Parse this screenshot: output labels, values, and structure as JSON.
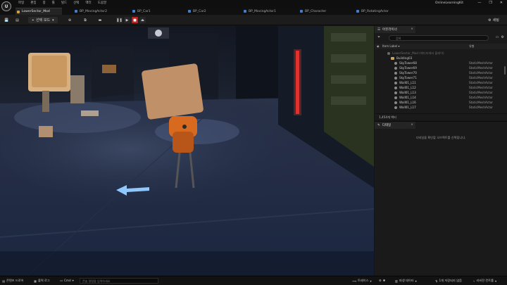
{
  "app": {
    "logo": "U",
    "menu": [
      "파일",
      "편집",
      "창",
      "툴",
      "빌드",
      "선택",
      "액터",
      "도움말"
    ],
    "project_name": "OnlineLearningKit",
    "window_controls": [
      "—",
      "❐",
      "✕"
    ]
  },
  "tabs": [
    {
      "label": "LowerSector_Mod",
      "icon": "level-icon",
      "active": true
    },
    {
      "label": "BP_MovingActor2",
      "icon": "blueprint-icon",
      "active": false
    },
    {
      "label": "BP_Car1",
      "icon": "blueprint-icon",
      "active": false
    },
    {
      "label": "BP_Car2",
      "icon": "blueprint-icon",
      "active": false
    },
    {
      "label": "BP_MovingActor1",
      "icon": "blueprint-icon",
      "active": false
    },
    {
      "label": "BP_Character",
      "icon": "blueprint-icon",
      "active": false
    },
    {
      "label": "BP_RotatingActor",
      "icon": "blueprint-icon",
      "active": false
    }
  ],
  "toolbar": {
    "save_icon": "💾",
    "content_icon": "▤",
    "selection_mode_label": "선택 모드",
    "add_icon": "⊕",
    "blueprint_icon": "⧉",
    "cinematics_icon": "▬",
    "pause_icon": "❚❚",
    "play_icon": "▶",
    "stop_icon": "■",
    "eject_icon": "⏏",
    "settings_label": "세팅"
  },
  "outliner": {
    "tab_label": "아웃라이너",
    "search_placeholder": "검색",
    "col_label": "Item Label ▾",
    "col_type": "유형",
    "rows": [
      {
        "label": "LowerSector_Mod (에디터에서 플레이)",
        "type": "",
        "indent": 1,
        "kind": "world",
        "dim": true
      },
      {
        "label": "Building03",
        "type": "",
        "indent": 2,
        "kind": "folder",
        "dim": false
      },
      {
        "label": "SkyTower68",
        "type": "StaticMeshActor",
        "indent": 3,
        "kind": "actor",
        "dim": false
      },
      {
        "label": "SkyTower69",
        "type": "StaticMeshActor",
        "indent": 3,
        "kind": "actor",
        "dim": false
      },
      {
        "label": "SkyTower70",
        "type": "StaticMeshActor",
        "indent": 3,
        "kind": "actor",
        "dim": false
      },
      {
        "label": "SkyTower71",
        "type": "StaticMeshActor",
        "indent": 3,
        "kind": "actor",
        "dim": false
      },
      {
        "label": "Wall01_L11",
        "type": "StaticMeshActor",
        "indent": 3,
        "kind": "actor",
        "dim": false
      },
      {
        "label": "Wall01_L12",
        "type": "StaticMeshActor",
        "indent": 3,
        "kind": "actor",
        "dim": false
      },
      {
        "label": "Wall01_L13",
        "type": "StaticMeshActor",
        "indent": 3,
        "kind": "actor",
        "dim": false
      },
      {
        "label": "Wall01_L14",
        "type": "StaticMeshActor",
        "indent": 3,
        "kind": "actor",
        "dim": false
      },
      {
        "label": "Wall01_L16",
        "type": "StaticMeshActor",
        "indent": 3,
        "kind": "actor",
        "dim": false
      },
      {
        "label": "Wall01_L17",
        "type": "StaticMeshActor",
        "indent": 3,
        "kind": "actor",
        "dim": false
      }
    ],
    "footer": "1,454개 액터"
  },
  "details": {
    "tab_label": "디테일",
    "empty_message": "디테일을 확인할 오브젝트를 선택합니다."
  },
  "statusbar": {
    "content_drawer": "콘텐츠 드로어",
    "output_log": "출력 로그",
    "cmd_label": "Cmd",
    "cmd_placeholder": "콘솔 명령을 입력하세요",
    "trace": "트레이스",
    "derived_data": "파생 데이터",
    "unsaved": "1개 저장되지 않음",
    "source_control": "리비전 컨트롤"
  },
  "colors": {
    "accent_level_tab": "#d8a23a",
    "blueprint_tab": "#3f7fd6",
    "stop_button": "#c02020"
  }
}
